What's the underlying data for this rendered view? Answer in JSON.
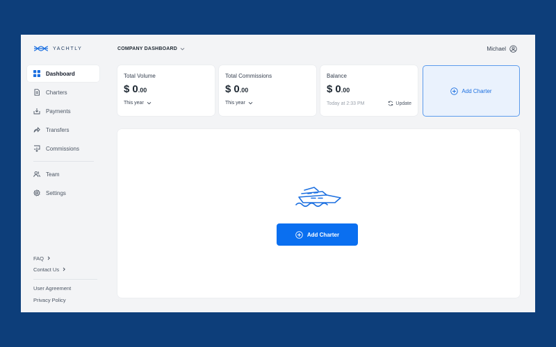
{
  "brand": {
    "name": "YACHTLY",
    "icon": "knot-logo-icon",
    "color": "#1f3a5f"
  },
  "header": {
    "company_label": "COMPANY DASHBOARD",
    "user_name": "Michael"
  },
  "sidebar": {
    "items": [
      {
        "label": "Dashboard",
        "icon": "grid-icon",
        "active": true
      },
      {
        "label": "Charters",
        "icon": "document-icon"
      },
      {
        "label": "Payments",
        "icon": "inbox-download-icon"
      },
      {
        "label": "Transfers",
        "icon": "share-arrow-icon"
      },
      {
        "label": "Commissions",
        "icon": "chat-download-icon"
      },
      {
        "label": "Team",
        "icon": "people-icon"
      },
      {
        "label": "Settings",
        "icon": "gear-icon"
      }
    ],
    "help_links": [
      {
        "label": "FAQ"
      },
      {
        "label": "Contact Us"
      }
    ],
    "legal_links": [
      {
        "label": "User Agreement"
      },
      {
        "label": "Privacy Policy"
      }
    ]
  },
  "cards": [
    {
      "label": "Total Volume",
      "currency": "$",
      "whole": "0",
      "cents": ".00",
      "period": "This year"
    },
    {
      "label": "Total Commissions",
      "currency": "$",
      "whole": "0",
      "cents": ".00",
      "period": "This year"
    },
    {
      "label": "Balance",
      "currency": "$",
      "whole": "0",
      "cents": ".00",
      "timestamp": "Today at 2:33 PM",
      "update_label": "Update"
    }
  ],
  "add_charter_card": {
    "label": "Add Charter"
  },
  "empty_state": {
    "icon": "yacht-icon",
    "button_label": "Add Charter"
  },
  "colors": {
    "accent": "#0a6ff0",
    "background": "#0d3e7a",
    "accent_light": "#eaf2fd"
  }
}
